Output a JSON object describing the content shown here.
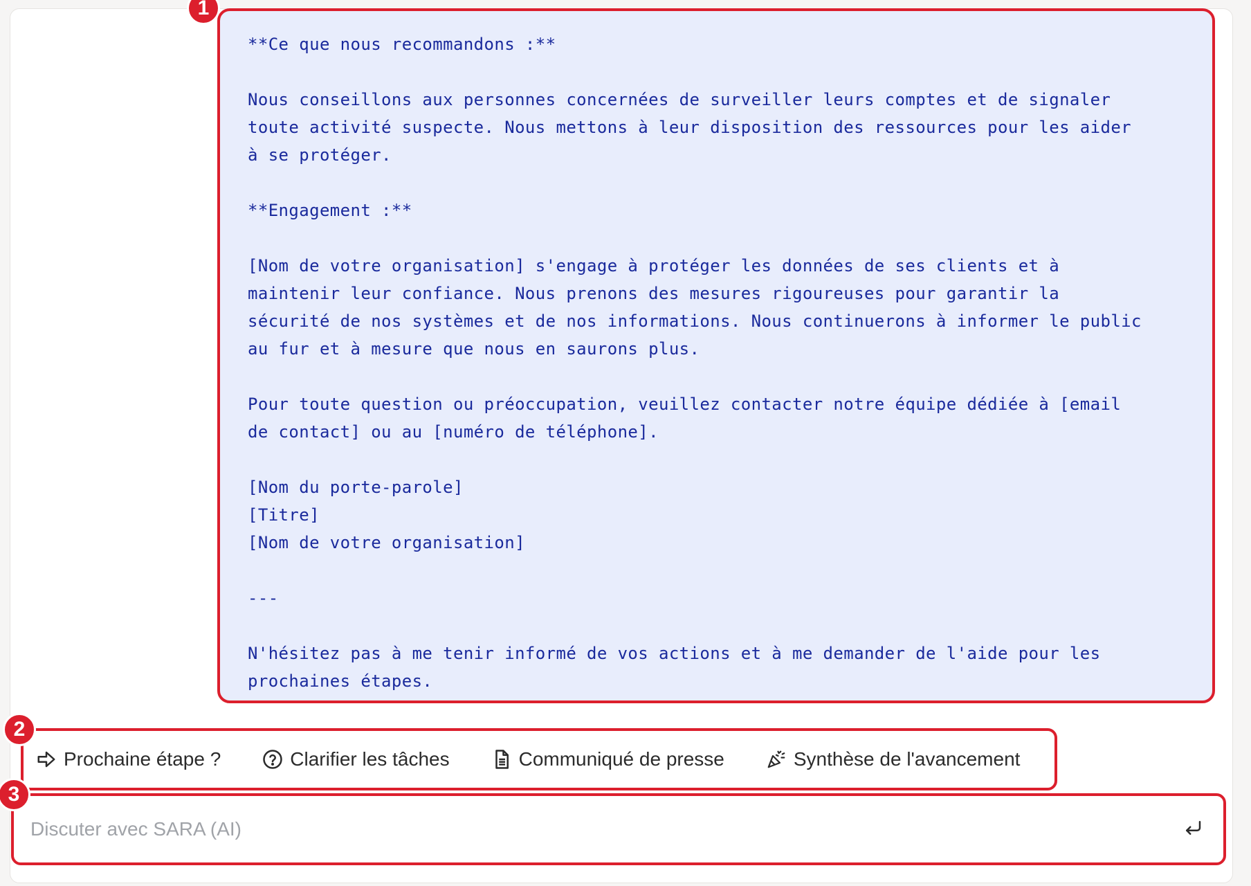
{
  "assistant_message": {
    "text": "**Ce que nous recommandons :**\n\nNous conseillons aux personnes concernées de surveiller leurs comptes et de signaler\ntoute activité suspecte. Nous mettons à leur disposition des ressources pour les aider\nà se protéger.\n\n**Engagement :**\n\n[Nom de votre organisation] s'engage à protéger les données de ses clients et à\nmaintenir leur confiance. Nous prenons des mesures rigoureuses pour garantir la\nsécurité de nos systèmes et de nos informations. Nous continuerons à informer le public\nau fur et à mesure que nous en saurons plus.\n\nPour toute question ou préoccupation, veuillez contacter notre équipe dédiée à [email\nde contact] ou au [numéro de téléphone].\n\n[Nom du porte-parole]\n[Titre]\n[Nom de votre organisation]\n\n---\n\nN'hésitez pas à me tenir informé de vos actions et à me demander de l'aide pour les\nprochaines étapes."
  },
  "annotations": [
    "1",
    "2",
    "3"
  ],
  "quick_actions": [
    {
      "label": "Prochaine étape ?",
      "icon": "arrow-right-icon"
    },
    {
      "label": "Clarifier les tâches",
      "icon": "question-circle-icon"
    },
    {
      "label": "Communiqué de presse",
      "icon": "document-icon"
    },
    {
      "label": "Synthèse de l'avancement",
      "icon": "party-popper-icon"
    }
  ],
  "composer": {
    "placeholder": "Discuter avec SARA (AI)",
    "send_icon": "enter-icon"
  },
  "colors": {
    "annotation_red": "#dc1f2d",
    "message_bg": "#e8edfc",
    "message_text": "#1a2a9c"
  }
}
